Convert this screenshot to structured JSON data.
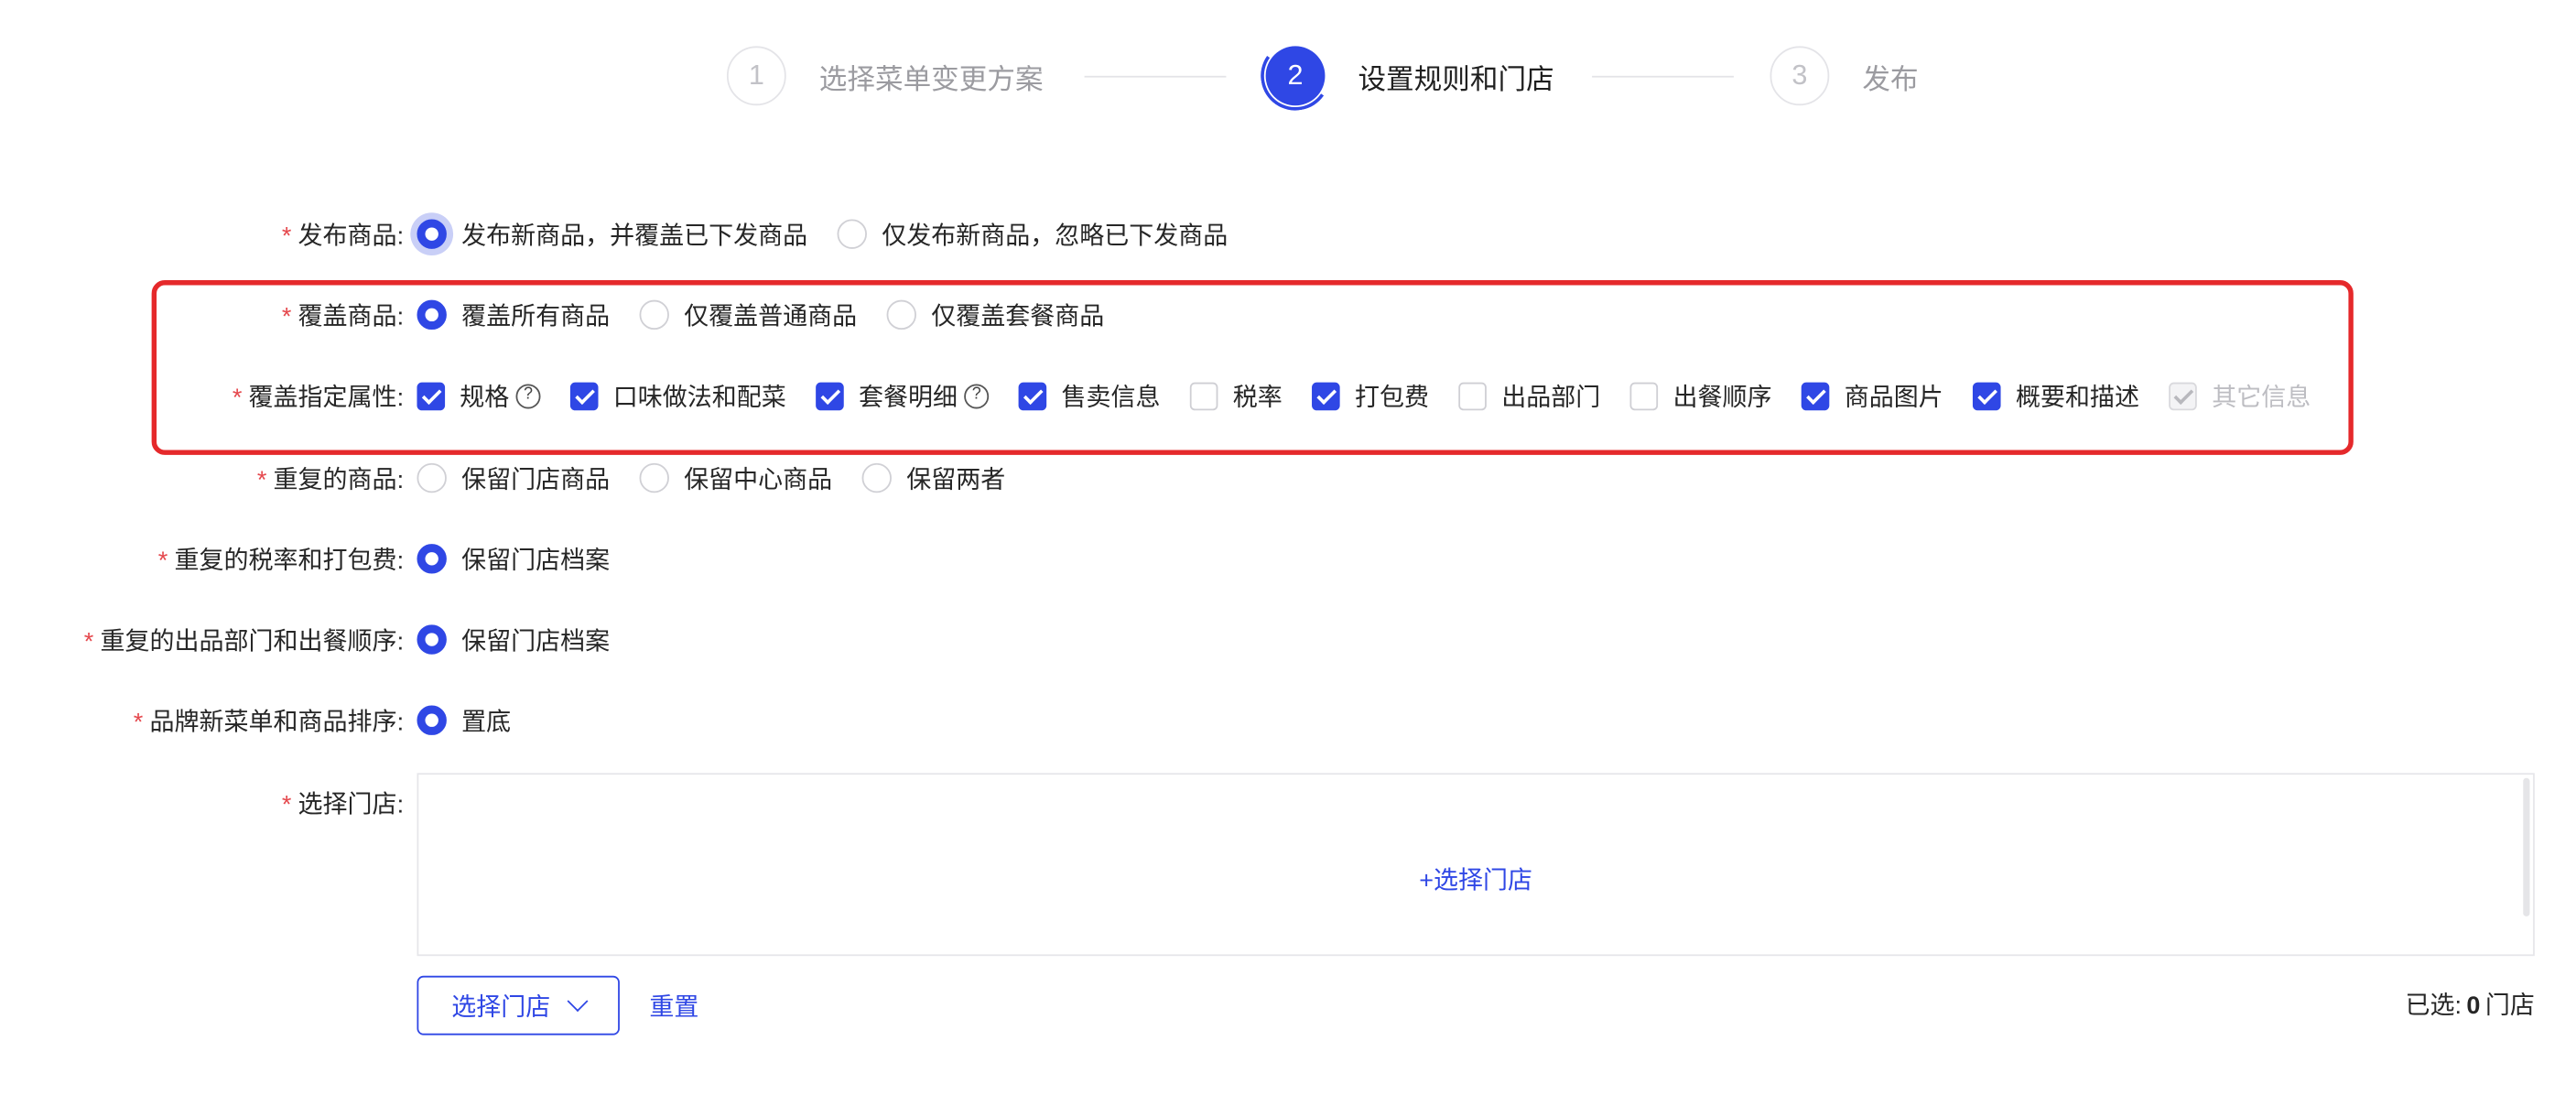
{
  "steps": [
    {
      "number": "1",
      "label": "选择菜单变更方案",
      "state": "pending"
    },
    {
      "number": "2",
      "label": "设置规则和门店",
      "state": "active"
    },
    {
      "number": "3",
      "label": "发布",
      "state": "pending"
    }
  ],
  "colors": {
    "primary": "#2f47e5",
    "required": "#e5484d",
    "highlight": "#e5292b"
  },
  "form": {
    "publish_goods": {
      "label": "发布商品:",
      "options": [
        "发布新商品，并覆盖已下发商品",
        "仅发布新商品，忽略已下发商品"
      ],
      "selected": 0
    },
    "cover_goods": {
      "label": "覆盖商品:",
      "options": [
        "覆盖所有商品",
        "仅覆盖普通商品",
        "仅覆盖套餐商品"
      ],
      "selected": 0
    },
    "cover_attrs": {
      "label": "覆盖指定属性:",
      "options": [
        {
          "label": "规格",
          "checked": true,
          "help": true
        },
        {
          "label": "口味做法和配菜",
          "checked": true
        },
        {
          "label": "套餐明细",
          "checked": true,
          "help": true
        },
        {
          "label": "售卖信息",
          "checked": true
        },
        {
          "label": "税率",
          "checked": false
        },
        {
          "label": "打包费",
          "checked": true
        },
        {
          "label": "出品部门",
          "checked": false
        },
        {
          "label": "出餐顺序",
          "checked": false
        },
        {
          "label": "商品图片",
          "checked": true
        },
        {
          "label": "概要和描述",
          "checked": true
        },
        {
          "label": "其它信息",
          "checked": true,
          "disabled": true
        }
      ]
    },
    "duplicate_goods": {
      "label": "重复的商品:",
      "options": [
        "保留门店商品",
        "保留中心商品",
        "保留两者"
      ],
      "selected": -1
    },
    "duplicate_tax_fee": {
      "label": "重复的税率和打包费:",
      "options": [
        "保留门店档案"
      ],
      "selected": 0
    },
    "duplicate_dept_order": {
      "label": "重复的出品部门和出餐顺序:",
      "options": [
        "保留门店档案"
      ],
      "selected": 0
    },
    "brand_sort": {
      "label": "品牌新菜单和商品排序:",
      "options": [
        "置底"
      ],
      "selected": 0
    },
    "select_store": {
      "label": "选择门店:",
      "add_link": "+选择门店",
      "select_button": "选择门店",
      "reset_link": "重置",
      "selected_prefix": "已选:",
      "selected_count": "0",
      "selected_suffix": "门店"
    }
  }
}
